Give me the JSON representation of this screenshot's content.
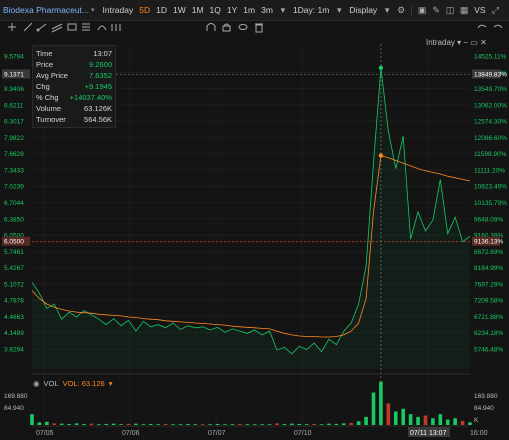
{
  "toolbar": {
    "title": "Biodexa Pharmaceut...",
    "periods": [
      "Intraday",
      "5D",
      "1D",
      "1W",
      "1M",
      "1Q",
      "1Y",
      "1m",
      "3m"
    ],
    "active_period": "5D",
    "interval": "1Day: 1m",
    "display_label": "Display",
    "vs_label": "VS"
  },
  "info_panel": {
    "rows": [
      {
        "label": "Time",
        "value": "13:07"
      },
      {
        "label": "Price",
        "value": "9.2600"
      },
      {
        "label": "Avg Price",
        "value": "7.6352"
      },
      {
        "label": "Chg",
        "value": "+9.1945"
      },
      {
        "label": "% Chg",
        "value": "+14037.40%"
      },
      {
        "label": "Volume",
        "value": "63.126K"
      },
      {
        "label": "Turnover",
        "value": "564.56K"
      }
    ]
  },
  "chart_label": "Intraday",
  "crosshair_price": "9.1371",
  "crosshair_pct": "13849.83%",
  "ref_price": "6.0500",
  "ref_pct": "9136.13%",
  "date_labels": [
    "07/05",
    "07/06",
    "07/07",
    "07/10",
    "07/11 13:07",
    "16:00"
  ],
  "vol_legend": {
    "label": "VOL",
    "value_label": "VOL: 63.126"
  },
  "vol_axis": [
    "169.880",
    "84.940",
    "K"
  ],
  "colors": {
    "up": "#18c964",
    "avg": "#ff8a1f",
    "ref": "#c0392b",
    "bg": "#141414"
  },
  "chart_data": {
    "type": "line",
    "y_left_ticks": [
      "9.5794",
      "9.2600",
      "8.9406",
      "8.6211",
      "8.3017",
      "7.9822",
      "7.6628",
      "7.3433",
      "7.0239",
      "6.7044",
      "6.3850",
      "6.0500",
      "5.7461",
      "5.4267",
      "5.1072",
      "4.7878",
      "4.4663",
      "4.1489",
      "3.8294"
    ],
    "y_right_ticks": [
      "14525.11%",
      "14037.40%",
      "13549.70%",
      "13062.00%",
      "12574.30%",
      "12086.60%",
      "11598.90%",
      "11111.20%",
      "10623.49%",
      "10135.79%",
      "9648.09%",
      "9160.39%",
      "8672.69%",
      "8184.99%",
      "7697.29%",
      "7209.58%",
      "6721.88%",
      "6234.18%",
      "5746.48%"
    ],
    "ylim": [
      3.7,
      9.7
    ],
    "series": [
      {
        "name": "Price",
        "values": [
          5.3,
          5.1,
          4.82,
          4.9,
          4.62,
          4.75,
          4.66,
          4.78,
          4.7,
          4.62,
          4.52,
          4.63,
          4.5,
          4.6,
          4.4,
          4.58,
          4.48,
          4.52,
          4.46,
          4.55,
          4.43,
          4.5,
          4.46,
          4.48,
          4.42,
          4.47,
          4.38,
          4.44,
          4.4,
          4.36,
          4.42,
          4.33,
          4.4,
          4.05,
          4.1,
          3.98,
          4.12,
          4.06,
          4.18,
          4.02,
          4.25,
          4.15,
          4.4,
          4.55,
          4.9,
          5.6,
          7.5,
          9.26,
          8.1,
          7.4,
          8.0,
          6.1,
          6.6,
          6.25,
          6.45,
          7.2,
          6.2,
          6.5,
          6.05,
          6.15
        ]
      },
      {
        "name": "Avg Price",
        "values": [
          5.15,
          5.0,
          4.9,
          4.84,
          4.8,
          4.77,
          4.75,
          4.74,
          4.73,
          4.71,
          4.7,
          4.69,
          4.68,
          4.66,
          4.65,
          4.63,
          4.62,
          4.61,
          4.59,
          4.58,
          4.57,
          4.56,
          4.55,
          4.54,
          4.53,
          4.52,
          4.51,
          4.49,
          4.48,
          4.47,
          4.46,
          4.45,
          4.44,
          4.4,
          4.36,
          4.33,
          4.31,
          4.3,
          4.3,
          4.29,
          4.29,
          4.3,
          4.33,
          4.4,
          4.55,
          5.0,
          6.6,
          7.64,
          7.6,
          7.55,
          7.5,
          7.45,
          7.4,
          7.36,
          7.33,
          7.3,
          7.26,
          7.23,
          7.2,
          7.17
        ]
      }
    ],
    "volume": [
      40,
      10,
      12,
      6,
      5,
      4,
      6,
      4,
      5,
      3,
      4,
      5,
      3,
      4,
      5,
      3,
      4,
      3,
      4,
      3,
      3,
      4,
      3,
      3,
      3,
      4,
      3,
      3,
      4,
      3,
      3,
      3,
      3,
      6,
      4,
      5,
      4,
      3,
      4,
      3,
      5,
      4,
      6,
      8,
      14,
      30,
      120,
      160,
      80,
      50,
      60,
      40,
      30,
      35,
      25,
      40,
      20,
      25,
      15,
      10
    ],
    "x_labels": [
      "07/05",
      "07/06",
      "07/07",
      "07/10",
      "07/11 13:07",
      "16:00"
    ]
  }
}
